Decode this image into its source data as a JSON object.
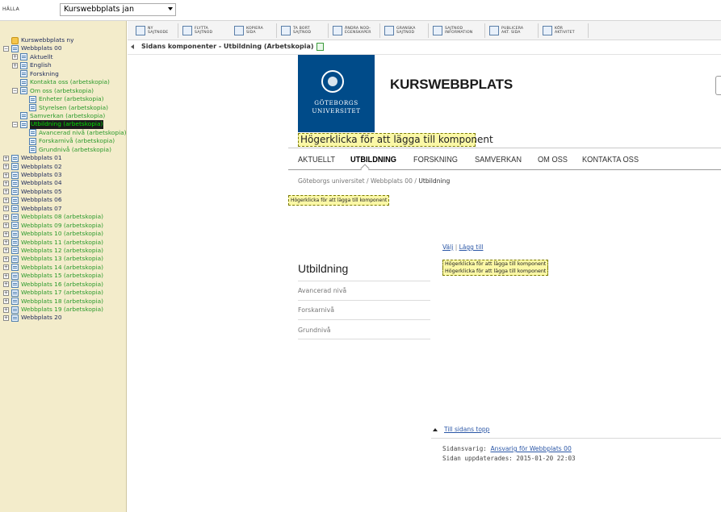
{
  "topbar": {
    "label": "HÄLLA",
    "site_select": "Kurswebbplats jan"
  },
  "tree": {
    "items": [
      {
        "label": "Kurswebbplats ny",
        "level": 0,
        "exp": "",
        "kind": "root",
        "state": "normal"
      },
      {
        "label": "Webbplats 00",
        "level": 0,
        "exp": "−",
        "kind": "page",
        "state": "normal"
      },
      {
        "label": "Aktuellt",
        "level": 1,
        "exp": "+",
        "kind": "page",
        "state": "normal"
      },
      {
        "label": "English",
        "level": 1,
        "exp": "+",
        "kind": "page",
        "state": "normal"
      },
      {
        "label": "Forskning",
        "level": 1,
        "exp": "",
        "kind": "page",
        "state": "normal"
      },
      {
        "label": "Kontakta oss (arbetskopia)",
        "level": 1,
        "exp": "",
        "kind": "page",
        "state": "draft"
      },
      {
        "label": "Om oss (arbetskopia)",
        "level": 1,
        "exp": "−",
        "kind": "page",
        "state": "draft"
      },
      {
        "label": "Enheter (arbetskopia)",
        "level": 2,
        "exp": "",
        "kind": "page",
        "state": "draft"
      },
      {
        "label": "Styrelsen (arbetskopia)",
        "level": 2,
        "exp": "",
        "kind": "page",
        "state": "draft"
      },
      {
        "label": "Samverkan (arbetskopia)",
        "level": 1,
        "exp": "",
        "kind": "page",
        "state": "draft"
      },
      {
        "label": "Utbildning (arbetskopia)",
        "level": 1,
        "exp": "−",
        "kind": "page",
        "state": "selected"
      },
      {
        "label": "Avancerad nivå (arbetskopia)",
        "level": 2,
        "exp": "",
        "kind": "page",
        "state": "draft"
      },
      {
        "label": "Forskarnivå (arbetskopia)",
        "level": 2,
        "exp": "",
        "kind": "page",
        "state": "draft"
      },
      {
        "label": "Grundnivå (arbetskopia)",
        "level": 2,
        "exp": "",
        "kind": "page",
        "state": "draft"
      },
      {
        "label": "Webbplats 01",
        "level": 0,
        "exp": "+",
        "kind": "page",
        "state": "normal"
      },
      {
        "label": "Webbplats 02",
        "level": 0,
        "exp": "+",
        "kind": "page",
        "state": "normal"
      },
      {
        "label": "Webbplats 03",
        "level": 0,
        "exp": "+",
        "kind": "page",
        "state": "normal"
      },
      {
        "label": "Webbplats 04",
        "level": 0,
        "exp": "+",
        "kind": "page",
        "state": "normal"
      },
      {
        "label": "Webbplats 05",
        "level": 0,
        "exp": "+",
        "kind": "page",
        "state": "normal"
      },
      {
        "label": "Webbplats 06",
        "level": 0,
        "exp": "+",
        "kind": "page",
        "state": "normal"
      },
      {
        "label": "Webbplats 07",
        "level": 0,
        "exp": "+",
        "kind": "page",
        "state": "normal"
      },
      {
        "label": "Webbplats 08 (arbetskopia)",
        "level": 0,
        "exp": "+",
        "kind": "page",
        "state": "draft"
      },
      {
        "label": "Webbplats 09 (arbetskopia)",
        "level": 0,
        "exp": "+",
        "kind": "page",
        "state": "draft"
      },
      {
        "label": "Webbplats 10 (arbetskopia)",
        "level": 0,
        "exp": "+",
        "kind": "page",
        "state": "draft"
      },
      {
        "label": "Webbplats 11 (arbetskopia)",
        "level": 0,
        "exp": "+",
        "kind": "page",
        "state": "draft"
      },
      {
        "label": "Webbplats 12 (arbetskopia)",
        "level": 0,
        "exp": "+",
        "kind": "page",
        "state": "draft"
      },
      {
        "label": "Webbplats 13 (arbetskopia)",
        "level": 0,
        "exp": "+",
        "kind": "page",
        "state": "draft"
      },
      {
        "label": "Webbplats 14 (arbetskopia)",
        "level": 0,
        "exp": "+",
        "kind": "page",
        "state": "draft"
      },
      {
        "label": "Webbplats 15 (arbetskopia)",
        "level": 0,
        "exp": "+",
        "kind": "page",
        "state": "draft"
      },
      {
        "label": "Webbplats 16 (arbetskopia)",
        "level": 0,
        "exp": "+",
        "kind": "page",
        "state": "draft"
      },
      {
        "label": "Webbplats 17 (arbetskopia)",
        "level": 0,
        "exp": "+",
        "kind": "page",
        "state": "draft"
      },
      {
        "label": "Webbplats 18 (arbetskopia)",
        "level": 0,
        "exp": "+",
        "kind": "page",
        "state": "draft"
      },
      {
        "label": "Webbplats 19 (arbetskopia)",
        "level": 0,
        "exp": "+",
        "kind": "page",
        "state": "draft"
      },
      {
        "label": "Webbplats 20",
        "level": 0,
        "exp": "+",
        "kind": "page",
        "state": "normal"
      }
    ]
  },
  "toolbar": {
    "buttons": [
      {
        "line1": "NY",
        "line2": "SAJTNODE",
        "icon": "new-node-icon"
      },
      {
        "line1": "FLYTTA",
        "line2": "SAJTNOD",
        "icon": "move-node-icon"
      },
      {
        "line1": "KOPIERA",
        "line2": "SIDA",
        "icon": "copy-page-icon"
      },
      {
        "line1": "TA BORT",
        "line2": "SAJTNOD",
        "icon": "delete-icon"
      },
      {
        "line1": "ÄNDRA NOD-",
        "line2": "EGENSKAPER",
        "icon": "properties-icon"
      },
      {
        "line1": "GRANSKA",
        "line2": "SAJTNOD",
        "icon": "review-icon"
      },
      {
        "line1": "SAJTNOD",
        "line2": "INFORMATION",
        "icon": "info-icon"
      },
      {
        "line1": "PUBLICERA",
        "line2": "AKT. SIDA",
        "icon": "publish-icon"
      },
      {
        "line1": "KÖR",
        "line2": "AKTIVITET",
        "icon": "run-activity-icon"
      }
    ]
  },
  "components_header": "Sidans komponenter - Utbildning (Arbetskopia)",
  "preview": {
    "logo_line1": "GÖTEBORGS",
    "logo_line2": "UNIVERSITET",
    "site_name": "KURSWEBBPLATS",
    "hint_top": "Högerklicka för att lägga till komponent",
    "nav": [
      "AKTUELLT",
      "UTBILDNING",
      "FORSKNING",
      "SAMVERKAN",
      "OM OSS",
      "KONTAKTA OSS"
    ],
    "breadcrumb": {
      "part1": "Göteborgs universitet",
      "sep": " / ",
      "part2": "Webbplats 00",
      "current": "Utbildning"
    },
    "hint_small": "Högerklicka för att lägga till komponent",
    "admin": {
      "valj": "Välj",
      "sep": " | ",
      "lagg_till": "Lägg till"
    },
    "hint_a": "Högerklicka för att lägga till komponent",
    "hint_b": "Högerklicka för att lägga till komponent",
    "sub_title": "Utbildning",
    "sub_items": [
      "Avancerad nivå",
      "Forskarnivå",
      "Grundnivå"
    ],
    "top_link": "Till sidans topp",
    "footer": {
      "responsible_label": "Sidansvarig: ",
      "responsible_link": "Ansvarig för Webbplats 00",
      "updated": "Sidan uppdaterades: 2015-01-20 22:03"
    }
  }
}
